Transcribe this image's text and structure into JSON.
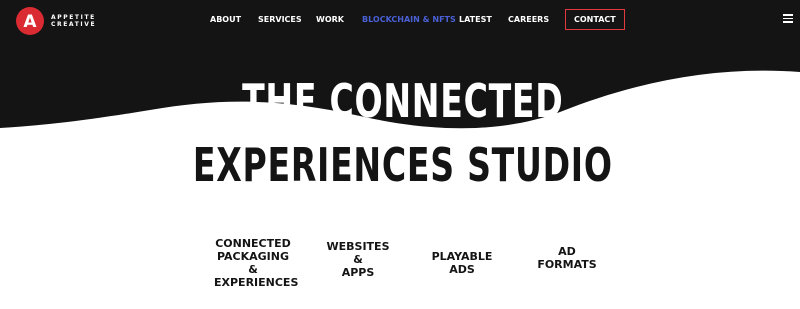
{
  "brand": {
    "name_line1": "APPETITE",
    "name_line2": "CREATIVE",
    "mark_letter": "A",
    "accent_color": "#d92b31"
  },
  "nav": {
    "items": [
      {
        "label": "ABOUT"
      },
      {
        "label": "SERVICES"
      },
      {
        "label": "WORK"
      },
      {
        "label": "BLOCKCHAIN & NFTS"
      },
      {
        "label": "LATEST"
      },
      {
        "label": "CAREERS"
      }
    ],
    "contact_label": "CONTACT",
    "active_color": "#4a60d6"
  },
  "hero": {
    "headline_line1": "THE CONNECTED",
    "headline_line2": "EXPERIENCES STUDIO"
  },
  "services": [
    {
      "line1": "CONNECTED",
      "line2": "PACKAGING &",
      "line3": "EXPERIENCES"
    },
    {
      "line1": "WEBSITES &",
      "line2": "APPS"
    },
    {
      "line1": "PLAYABLE ADS"
    },
    {
      "line1": "AD FORMATS"
    }
  ],
  "icons": {
    "menu": "hamburger-menu-icon"
  }
}
